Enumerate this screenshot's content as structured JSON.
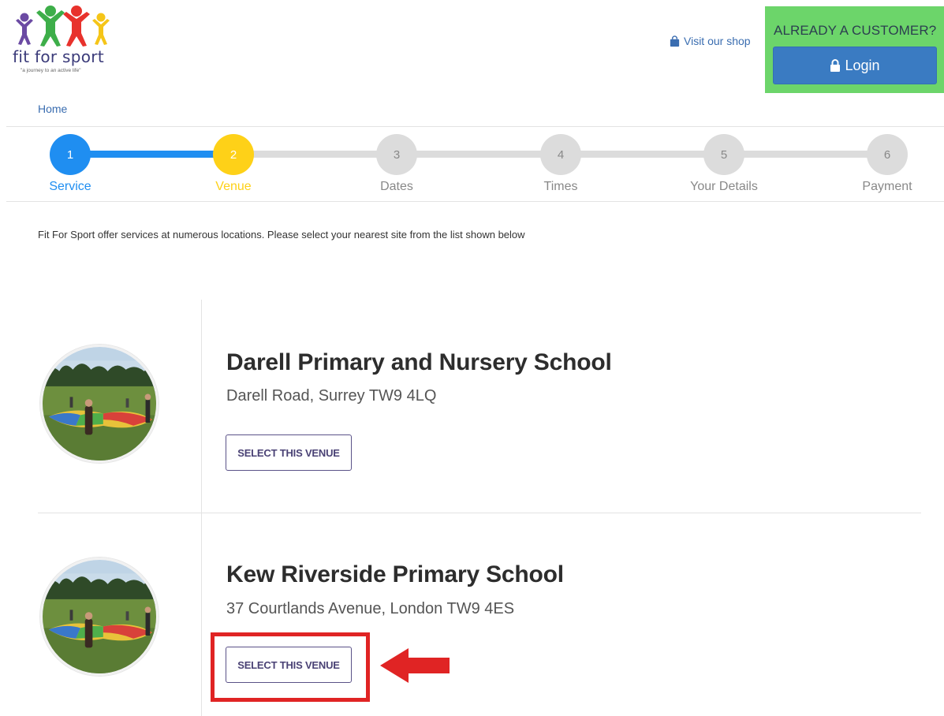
{
  "header": {
    "logo_text": "fit for sport",
    "logo_tagline": "\"a journey to an active life\"",
    "shop_link": "Visit our shop",
    "customer_title": "ALREADY A CUSTOMER?",
    "login_label": "Login"
  },
  "breadcrumb": "Home",
  "stepper": {
    "current_step": 2,
    "steps": [
      {
        "number": "1",
        "label": "Service",
        "state": "done"
      },
      {
        "number": "2",
        "label": "Venue",
        "state": "current"
      },
      {
        "number": "3",
        "label": "Dates",
        "state": "pending"
      },
      {
        "number": "4",
        "label": "Times",
        "state": "pending"
      },
      {
        "number": "5",
        "label": "Your Details",
        "state": "pending"
      },
      {
        "number": "6",
        "label": "Payment",
        "state": "pending"
      }
    ]
  },
  "intro_text": "Fit For Sport offer services at numerous locations.  Please select your nearest site from the list shown below",
  "venues": [
    {
      "name": "Darell Primary and Nursery School",
      "address": "Darell Road, Surrey TW9 4LQ",
      "button": "SELECT THIS VENUE"
    },
    {
      "name": "Kew Riverside Primary School",
      "address": "37 Courtlands Avenue, London TW9 4ES",
      "button": "SELECT THIS VENUE"
    }
  ],
  "colors": {
    "primary_blue": "#1f8ef1",
    "current_yellow": "#fed118",
    "customer_green": "#6cd56a",
    "login_blue": "#3a7bc2",
    "highlight_red": "#e02424"
  }
}
